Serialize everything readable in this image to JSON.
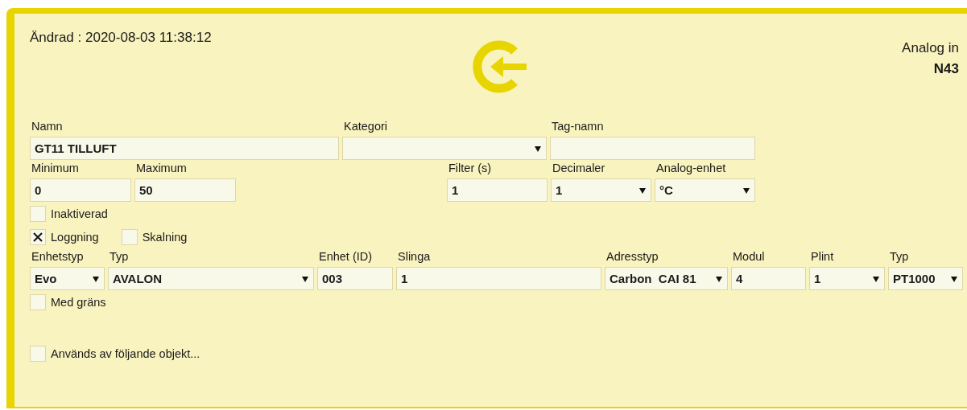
{
  "modified": "Ändrad : 2020-08-03 11:38:12",
  "header": {
    "type": "Analog in",
    "id": "N43"
  },
  "sections": [
    {
      "kind": "fields",
      "fields": [
        {
          "label": "Namn",
          "kind": "text",
          "value": "GT11 TILLUFT"
        },
        {
          "label": "Kategori",
          "kind": "select"
        },
        {
          "label": "Tag-namn",
          "kind": "text"
        }
      ]
    },
    {
      "kind": "fields",
      "fields": [
        {
          "label": "Minimum",
          "kind": "text",
          "value": "0"
        },
        {
          "label": "Maximum",
          "kind": "text",
          "value": "50"
        },
        {
          "label": "Filter (s)",
          "kind": "text",
          "value": "1"
        },
        {
          "label": "Decimaler",
          "kind": "select",
          "value": "1"
        },
        {
          "label": "Analog-enhet",
          "kind": "select",
          "value": "°C"
        }
      ]
    },
    {
      "kind": "checks",
      "items": [
        {
          "label": "Inaktiverad",
          "checked": false
        }
      ]
    },
    {
      "kind": "checks",
      "items": [
        {
          "label": "Loggning",
          "checked": true
        },
        {
          "label": "Skalning",
          "checked": false
        }
      ]
    },
    {
      "kind": "fields",
      "fields": [
        {
          "label": "Enhetstyp",
          "kind": "select",
          "value": "Evo"
        },
        {
          "label": "Typ",
          "kind": "select",
          "value": "AVALON"
        },
        {
          "label": "Enhet (ID)",
          "kind": "text",
          "value": "003"
        },
        {
          "label": "Slinga",
          "kind": "text",
          "value": "1"
        },
        {
          "label": "Adresstyp",
          "kind": "select",
          "value": "Carbon  CAI 81"
        },
        {
          "label": "Modul",
          "kind": "text",
          "value": "4"
        },
        {
          "label": "Plint",
          "kind": "select",
          "value": "1"
        },
        {
          "label": "Typ",
          "kind": "select",
          "value": "PT1000"
        }
      ]
    },
    {
      "kind": "checks",
      "items": [
        {
          "label": "Med gräns",
          "checked": false
        }
      ]
    },
    {
      "kind": "checks",
      "items": [
        {
          "label": "Används av följande objekt...",
          "checked": false
        }
      ]
    }
  ]
}
